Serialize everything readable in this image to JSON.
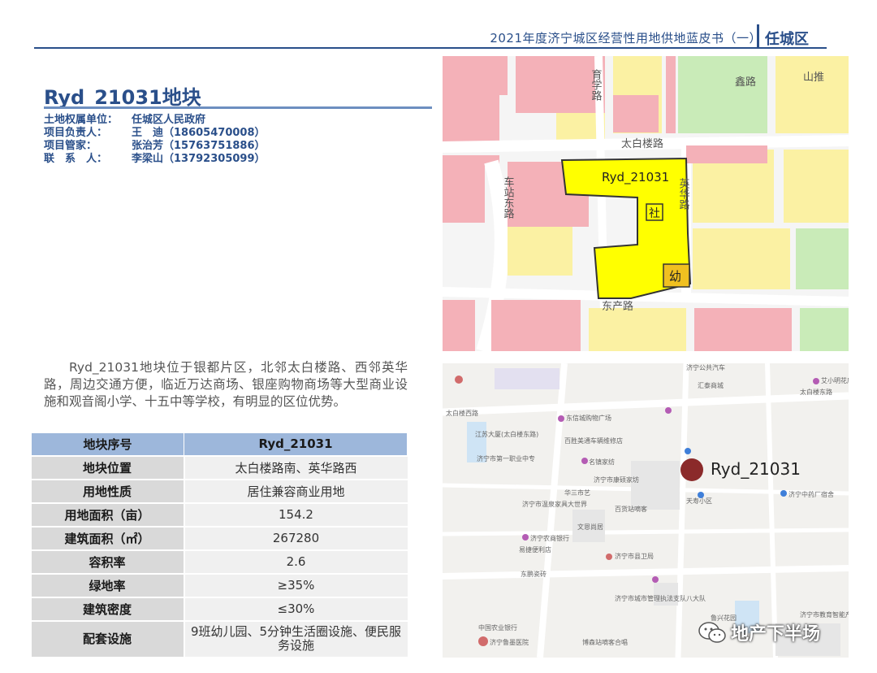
{
  "header": {
    "title": "2021年度济宁城区经营性用地供地蓝皮书（一）",
    "district": "任城区"
  },
  "parcel": {
    "title": "Ryd_21031地块",
    "contacts": [
      {
        "label": "土地权属单位：",
        "value": "任城区人民政府"
      },
      {
        "label": "项目负责人：",
        "value": "王　迪（18605470008）"
      },
      {
        "label": "项目管家：",
        "value": "张治芳（15763751886）"
      },
      {
        "label": "联　系　人：",
        "value": "李梁山（13792305099）"
      }
    ],
    "description": "Ryd_21031地块位于银都片区，北邻太白楼路、西邻英华路，周边交通方便，临近万达商场、银座购物商场等大型商业设施和观音阁小学、十五中等学校，有明显的区位优势。"
  },
  "table": {
    "header": [
      "地块序号",
      "Ryd_21031"
    ],
    "rows": [
      {
        "key": "地块位置",
        "value": "太白楼路南、英华路西"
      },
      {
        "key": "用地性质",
        "value": "居住兼容商业用地"
      },
      {
        "key": "用地面积（亩）",
        "value": "154.2"
      },
      {
        "key": "建筑面积（㎡）",
        "value": "267280"
      },
      {
        "key": "容积率",
        "value": "2.6"
      },
      {
        "key": "绿地率",
        "value": "≥35%"
      },
      {
        "key": "建筑密度",
        "value": "≤30%"
      },
      {
        "key": "配套设施",
        "value": "9班幼儿园、5分钟生活圈设施、便民服务设施"
      }
    ]
  },
  "planning_map": {
    "parcel_label": "Ryd_21031",
    "community_badge": "社",
    "kindergarten_badge": "幼",
    "road_taibai": "太白楼路",
    "road_vertical_left": "车站东路",
    "road_yinghua": "英华路",
    "road_bottom": "东产路",
    "road_top_left": "育学路",
    "road_top_right": "鑫路",
    "road_far_right": "山推",
    "colors": {
      "parcel": "#ffff00",
      "residential": "#fbf1a3",
      "commercial": "#f4b1b8",
      "green": "#c9ebb8"
    }
  },
  "location_map": {
    "marker_label": "Ryd_21031",
    "marker_color": "#8b2a2a",
    "pois": [
      "济宁公共汽车",
      "汇泰商城",
      "艾小明花店",
      "太白楼东路",
      "太白楼西路",
      "江苏大厦(太白楼东路)",
      "济宁市第一职业中专",
      "东信城购物广场",
      "百胜美通车辆维修店",
      "名镇家纺",
      "济宁市康硕家坊",
      "华三市艺",
      "济宁市温泉家具大世界",
      "百货站嘀客",
      "文恩尚居",
      "济宁农商银行",
      "易捷便利店",
      "东鹏瓷砖",
      "济宁市县卫局",
      "济宁市城市管理执法支队八大队",
      "天寿小区",
      "济宁中药厂宿舍",
      "济宁市教育智能产业园",
      "鲁兴花园",
      "济宁鲁墨医院",
      "博森站嘀客合唱",
      "中国农业银行"
    ]
  },
  "watermark": {
    "text": "地产下半场",
    "icon": "wechat-icon"
  }
}
